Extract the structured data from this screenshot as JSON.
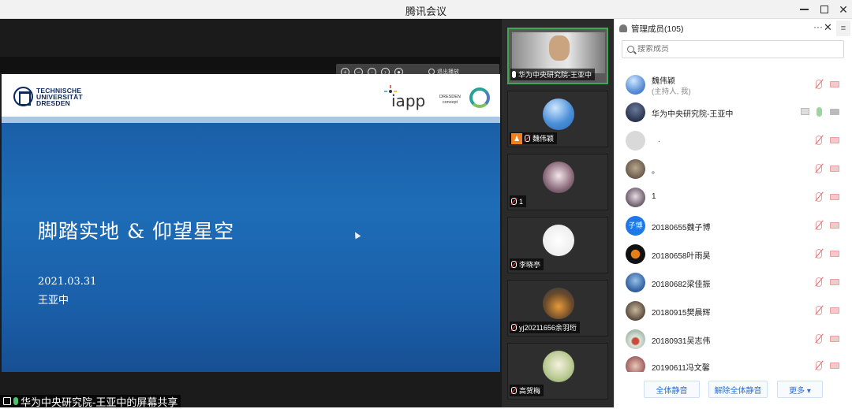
{
  "window": {
    "title": "腾讯会议"
  },
  "share": {
    "toolbar_exit": "退出播放",
    "label": "华为中央研究院-王亚中的屏幕共享",
    "slide": {
      "logo_text": [
        "TECHNISCHE",
        "UNIVERSITÄT",
        "DRESDEN"
      ],
      "iapp": "iapp",
      "dresden": [
        "DRESDEN",
        "concept"
      ],
      "title": "脚踏实地 & 仰望星空",
      "date": "2021.03.31",
      "author": "王亚中"
    }
  },
  "video_tiles": [
    {
      "name": "华为中央研究院-王亚中",
      "active": true,
      "avatar": "camera-feed"
    },
    {
      "name": "魏伟颖",
      "host": true,
      "avatar": "sky-photo"
    },
    {
      "name": "1",
      "avatar": "anime-portrait"
    },
    {
      "name": "李晓亭",
      "avatar": "sketch-portrait"
    },
    {
      "name": "yj20211656余羽珩",
      "avatar": "sunset-figure"
    },
    {
      "name": "高贺梅",
      "avatar": "green-illustration"
    }
  ],
  "panel": {
    "title": "管理成员(105)",
    "more": "···",
    "search_placeholder": "搜索成员",
    "members": [
      {
        "name": "魏伟颖",
        "sub": "(主持人, 我)",
        "avatar_color": "#5b8fd6",
        "mic": "off",
        "cam": "off"
      },
      {
        "name": "华为中央研究院-王亚中",
        "avatar_color": "#3a4a6a",
        "mic": "on",
        "cam": "on",
        "sharing": true
      },
      {
        "name": ".",
        "avatar_color": "#d9d9d9",
        "mic": "off",
        "cam": "off"
      },
      {
        "name": "。",
        "avatar_color": "#8a7a6a",
        "mic": "off",
        "cam": "off"
      },
      {
        "name": "1",
        "avatar_color": "#6a5a6a",
        "mic": "off",
        "cam": "off"
      },
      {
        "name": "20180655魏子博",
        "avatar_color": "#1e78e8",
        "avatar_text": "子博",
        "mic": "off",
        "cam": "off"
      },
      {
        "name": "20180658叶雨昊",
        "avatar_color": "#1a1a1a",
        "mic": "off",
        "cam": "off"
      },
      {
        "name": "20180682梁佳振",
        "avatar_color": "#3a6aa8",
        "mic": "off",
        "cam": "off"
      },
      {
        "name": "20180915樊晨辉",
        "avatar_color": "#5a4a3a",
        "mic": "off",
        "cam": "off"
      },
      {
        "name": "20180931吴志伟",
        "avatar_color": "#9ab0a0",
        "mic": "off",
        "cam": "off"
      },
      {
        "name": "20190611冯文馨",
        "avatar_color": "#a06060",
        "mic": "off",
        "cam": "off"
      }
    ],
    "buttons": {
      "mute_all": "全体静音",
      "unmute_all": "解除全体静音",
      "more": "更多 ▾"
    }
  }
}
